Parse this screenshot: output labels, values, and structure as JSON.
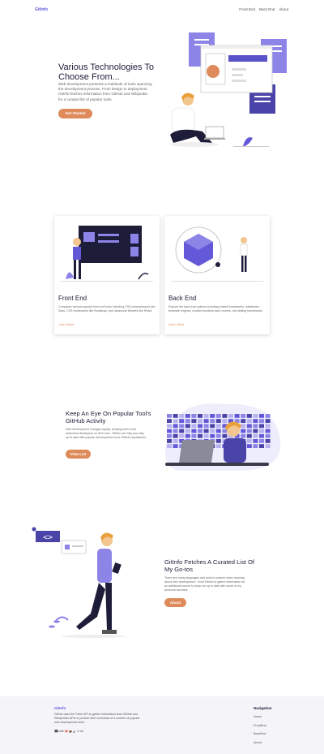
{
  "nav": {
    "brand": "GitInfo",
    "links": [
      "Front End",
      "Back End",
      "About"
    ]
  },
  "hero": {
    "title": "Various Technologies To Choose From...",
    "description": "Web development presents a multitude of tools spanning the development process. From design to deployment. GitInfo fetches information from GitHub and Wikipedia for a curated list of popular tools.",
    "button": "Get Started"
  },
  "cards": [
    {
      "title": "Front End",
      "description": "Compares various popular front end tools including CSS preprocessors like Sass, CSS frameworks like Bootstrap, and Javascript libraries like React.",
      "link": "Learn More"
    },
    {
      "title": "Back End",
      "description": "Explore the back end options including trusted frameworks, databases, template engines, module bundlers task runners, and testing frameworks.",
      "link": "Learn More"
    }
  ],
  "github_section": {
    "title": "Keep An Eye On Popular Tool's GitHub Activity",
    "description": "Web development changes rapidly, keeping even most seasoned developers on their toes. GitInfo can help you stay up to date with popular development tool's GitHub repositories.",
    "button": "View List"
  },
  "curated_section": {
    "title": "GitInfo Fetches A Curated List Of My Go-tos",
    "description": "There are many languages and tools to explore when learning about web development. I built GitInfo to gather information as an additional source to keep me up to date with some of my personal favorites.",
    "button": "About"
  },
  "footer": {
    "brand": "GitInfo",
    "description": "GitInfo uses the Fetch API to gather information from GitHub and Wikipedia's APIs to provide brief overviews of a number of popular web development tools.",
    "made_with_prefix": "with",
    "made_with_suffix": "& rai",
    "nav_heading": "Navigation",
    "nav_links": [
      "Home",
      "FrontEnd",
      "BackEnd",
      "About"
    ]
  },
  "colors": {
    "accent": "#6358d8",
    "button": "#de8a5a",
    "dark": "#1d1d3a"
  }
}
